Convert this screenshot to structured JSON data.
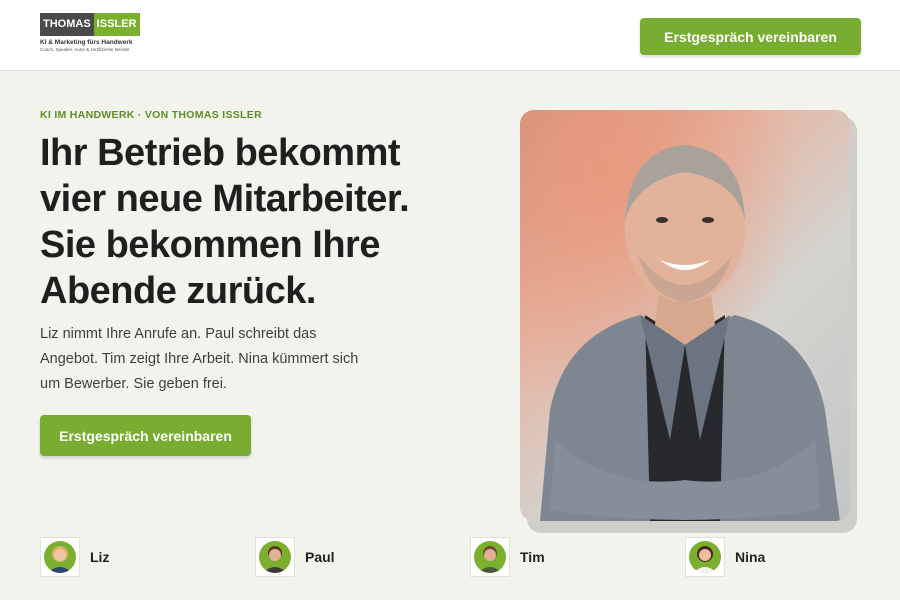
{
  "header": {
    "logo_part1": "THOMAS",
    "logo_part2": "ISSLER",
    "logo_tagline": "KI & Marketing fürs Handwerk",
    "logo_subline": "Coach, Speaker, Autor & zertifizierter Berater",
    "cta_label": "Erstgespräch vereinbaren"
  },
  "hero": {
    "eyebrow": "KI IM HANDWERK · VON THOMAS ISSLER",
    "headline": "Ihr Betrieb bekommt vier neue Mitarbeiter. Sie bekommen Ihre Abende zurück.",
    "lead": "Liz nimmt Ihre Anrufe an. Paul schreibt das Angebot. Tim zeigt Ihre Arbeit. Nina kümmert sich um Bewerber. Sie geben frei.",
    "cta_label": "Erstgespräch vereinbaren"
  },
  "team": [
    {
      "name": "Liz",
      "hair": "#d9b46a",
      "shirt": "#27456e"
    },
    {
      "name": "Paul",
      "hair": "#5a3b24",
      "shirt": "#3a3a3a"
    },
    {
      "name": "Tim",
      "hair": "#6b4a2e",
      "shirt": "#4a5a3a"
    },
    {
      "name": "Nina",
      "hair": "#4a2a1e",
      "shirt": "#f2f2f2"
    }
  ],
  "colors": {
    "accent": "#78ad31",
    "eyebrow": "#5c8e23",
    "background": "#f3f3ee"
  }
}
